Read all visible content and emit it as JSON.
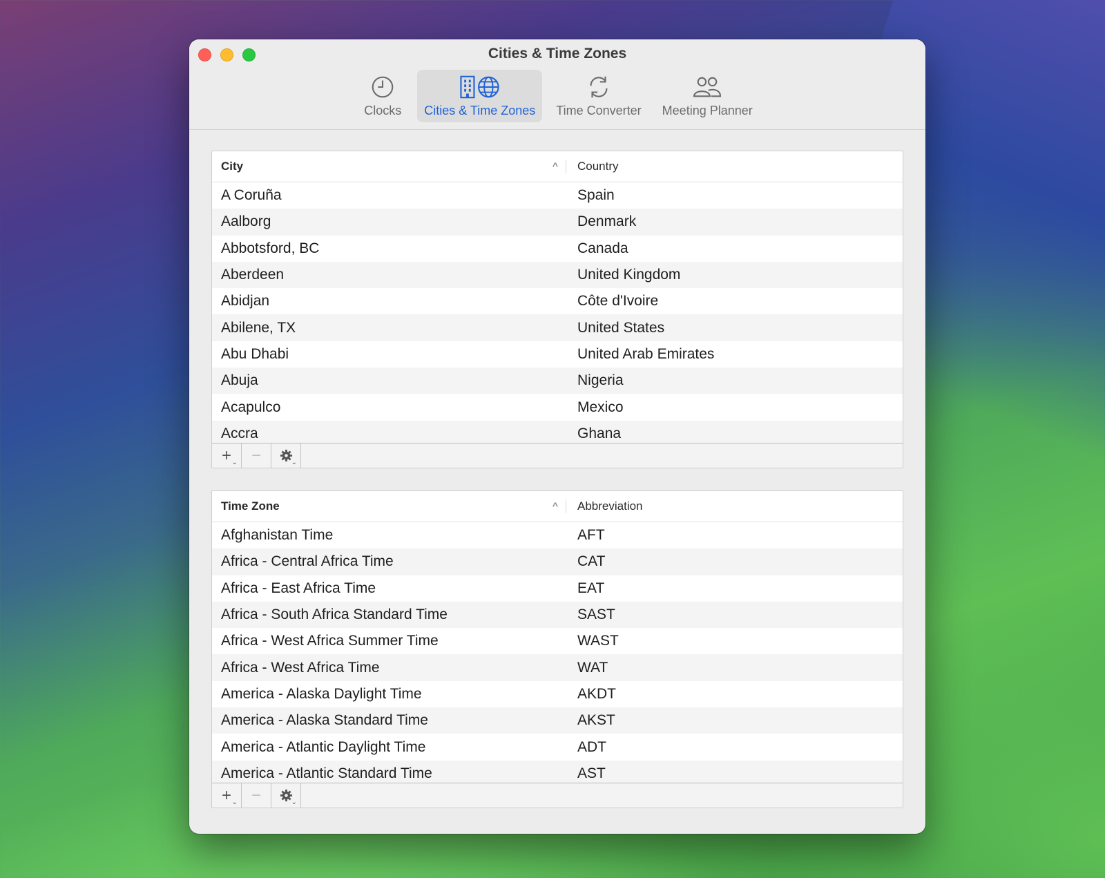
{
  "window": {
    "title": "Cities & Time Zones"
  },
  "toolbar": {
    "tabs": [
      {
        "label": "Clocks",
        "icon": "clock-icon",
        "active": false
      },
      {
        "label": "Cities & Time Zones",
        "icon": "building-globe-icon",
        "active": true
      },
      {
        "label": "Time Converter",
        "icon": "sync-icon",
        "active": false
      },
      {
        "label": "Meeting Planner",
        "icon": "people-icon",
        "active": false
      }
    ]
  },
  "cities_table": {
    "col_city": "City",
    "col_country": "Country",
    "sort_indicator": "^",
    "rows": [
      {
        "city": "A Coruña",
        "country": "Spain"
      },
      {
        "city": "Aalborg",
        "country": "Denmark"
      },
      {
        "city": "Abbotsford, BC",
        "country": "Canada"
      },
      {
        "city": "Aberdeen",
        "country": "United Kingdom"
      },
      {
        "city": "Abidjan",
        "country": "Côte d'Ivoire"
      },
      {
        "city": "Abilene, TX",
        "country": "United States"
      },
      {
        "city": "Abu Dhabi",
        "country": "United Arab Emirates"
      },
      {
        "city": "Abuja",
        "country": "Nigeria"
      },
      {
        "city": "Acapulco",
        "country": "Mexico"
      },
      {
        "city": "Accra",
        "country": "Ghana"
      }
    ]
  },
  "timezones_table": {
    "col_zone": "Time Zone",
    "col_abbr": "Abbreviation",
    "sort_indicator": "^",
    "rows": [
      {
        "zone": "Afghanistan Time",
        "abbr": "AFT"
      },
      {
        "zone": "Africa - Central Africa Time",
        "abbr": "CAT"
      },
      {
        "zone": "Africa - East Africa Time",
        "abbr": "EAT"
      },
      {
        "zone": "Africa - South Africa Standard Time",
        "abbr": "SAST"
      },
      {
        "zone": "Africa - West Africa Summer Time",
        "abbr": "WAST"
      },
      {
        "zone": "Africa - West Africa Time",
        "abbr": "WAT"
      },
      {
        "zone": "America - Alaska Daylight Time",
        "abbr": "AKDT"
      },
      {
        "zone": "America - Alaska Standard Time",
        "abbr": "AKST"
      },
      {
        "zone": "America - Atlantic Daylight Time",
        "abbr": "ADT"
      },
      {
        "zone": "America - Atlantic Standard Time",
        "abbr": "AST"
      }
    ]
  },
  "footer_buttons": {
    "add": "+",
    "remove": "−",
    "caret": "⌄"
  }
}
